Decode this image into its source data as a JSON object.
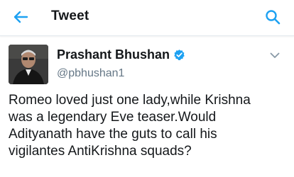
{
  "header": {
    "title": "Tweet",
    "back_icon": "back-arrow-icon",
    "search_icon": "search-icon"
  },
  "tweet": {
    "author": {
      "display_name": "Prashant Bhushan",
      "handle": "@pbhushan1",
      "verified": true
    },
    "text": "Romeo loved just one lady,while Krishna\nwas a legendary Eve teaser.Would\nAdityanath have the guts to call his\nvigilantes AntiKrishna squads?"
  },
  "colors": {
    "accent": "#1da1f2",
    "text_primary": "#14171a",
    "text_secondary": "#657786",
    "divider": "#e1e8ed"
  }
}
